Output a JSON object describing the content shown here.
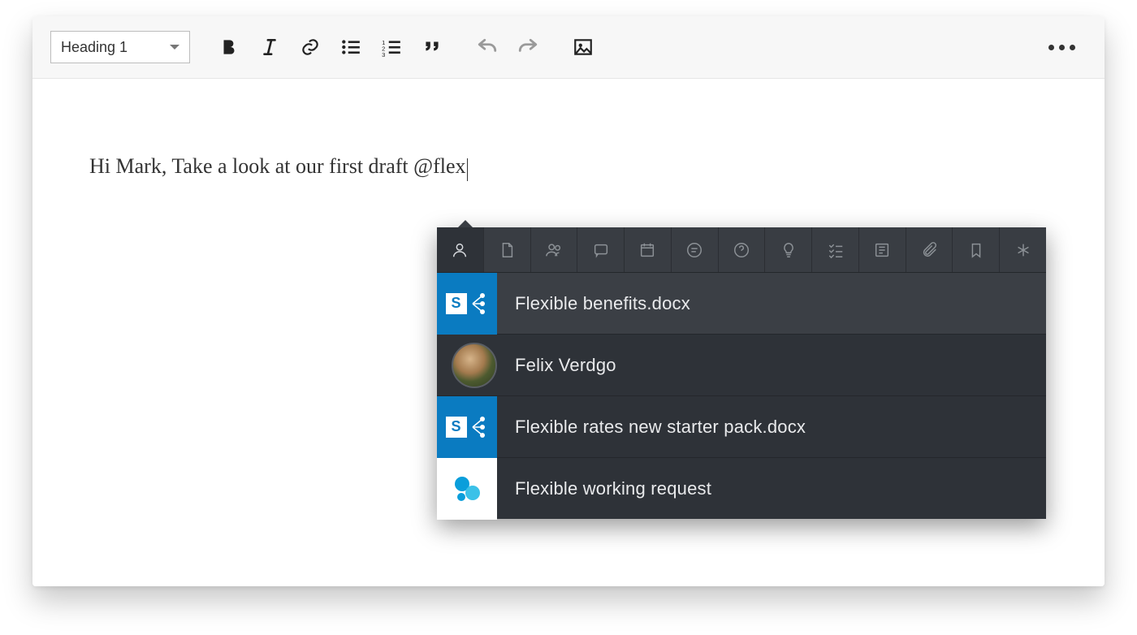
{
  "toolbar": {
    "heading_label": "Heading 1"
  },
  "editor": {
    "content": "Hi Mark, Take a look at our first draft @flex"
  },
  "mention_popup": {
    "tabs": [
      "person",
      "document",
      "people-group",
      "chat",
      "calendar",
      "text-circle",
      "help",
      "lightbulb",
      "task-list",
      "article",
      "attachment",
      "bookmark",
      "asterisk"
    ],
    "results": [
      {
        "type": "sharepoint",
        "label": "Flexible benefits.docx"
      },
      {
        "type": "person",
        "label": "Felix Verdgo"
      },
      {
        "type": "sharepoint",
        "label": "Flexible rates new starter pack.docx"
      },
      {
        "type": "generic",
        "label": "Flexible working request"
      }
    ],
    "selected_index": 0
  }
}
